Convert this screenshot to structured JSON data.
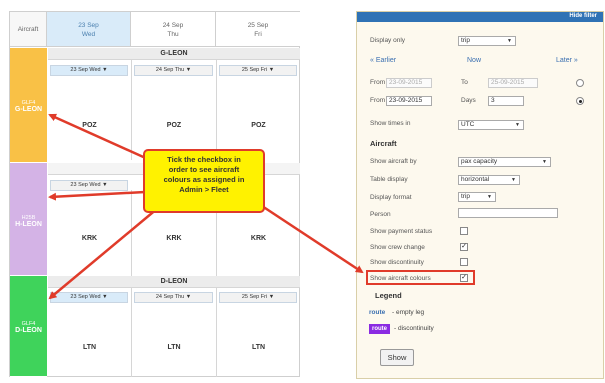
{
  "grid": {
    "aircraft_header": "Aircraft",
    "days": [
      {
        "date": "23 Sep",
        "dow": "Wed"
      },
      {
        "date": "24 Sep",
        "dow": "Thu"
      },
      {
        "date": "25 Sep",
        "dow": "Fri"
      }
    ],
    "rows": [
      {
        "type": "GLF4",
        "reg": "G-LEON",
        "color": "#f9c146",
        "day_heads": [
          "23 Sep Wed ▼",
          "24 Sep Thu ▼",
          "25 Sep Fri ▼"
        ],
        "legs": [
          "POZ",
          "POZ",
          "POZ"
        ]
      },
      {
        "type": "H25B",
        "reg": "H-LEON",
        "color": "#d4b3e6",
        "day_heads": [
          "23 Sep Wed ▼"
        ],
        "legs": [
          "KRK",
          "KRK",
          "KRK"
        ]
      },
      {
        "type": "GLF4",
        "reg": "D-LEON",
        "color": "#3fd35b",
        "day_heads": [
          "23 Sep Wed ▼",
          "24 Sep Thu ▼",
          "25 Sep Fri ▼"
        ],
        "legs": [
          "LTN",
          "LTN",
          "LTN"
        ]
      }
    ]
  },
  "callout": {
    "lines": [
      "Tick the checkbox in",
      "order to see aircraft",
      "colours as assigned in",
      "Admin > Fleet"
    ]
  },
  "filter": {
    "hide_filter": "Hide filter",
    "display_only_label": "Display only",
    "display_only_value": "trip",
    "earlier": "« Earlier",
    "now": "Now",
    "later": "Later »",
    "from_label": "From",
    "from_range_value": "23-09-2015",
    "to_label": "To",
    "to_value": "25-09-2015",
    "from_days_value": "23-09-2015",
    "days_label": "Days",
    "days_value": "3",
    "show_times_label": "Show times in",
    "show_times_value": "UTC",
    "aircraft_heading": "Aircraft",
    "show_aircraft_by_label": "Show aircraft by",
    "show_aircraft_by_value": "pax capacity",
    "table_display_label": "Table display",
    "table_display_value": "horizontal",
    "display_format_label": "Display format",
    "display_format_value": "trip",
    "person_label": "Person",
    "checkboxes": [
      {
        "label": "Show payment status",
        "checked": false
      },
      {
        "label": "Show crew change",
        "checked": true
      },
      {
        "label": "Show discontinuity",
        "checked": false
      },
      {
        "label": "Show aircraft colours",
        "checked": true
      }
    ],
    "legend_heading": "Legend",
    "legend_route_tag": "route",
    "legend_route_text": "- empty leg",
    "legend_node_tag": "route",
    "legend_node_text": "- discontinuity",
    "show_button": "Show",
    "node_color": "#8a2be2",
    "accent_color": "#2f72b5"
  }
}
